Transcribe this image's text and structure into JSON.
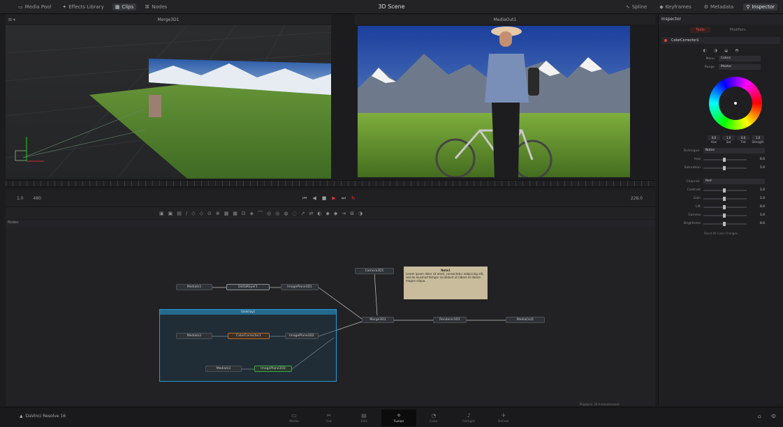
{
  "titlebar": {
    "title": "3D Scene",
    "left_buttons": [
      "Media Pool",
      "Effects Library",
      "Clips",
      "Nodes"
    ],
    "right_buttons": [
      "Spline",
      "Keyframes",
      "Metadata",
      "Inspector"
    ]
  },
  "viewer_left": {
    "name": "Merge3D1"
  },
  "viewer_right": {
    "name": "MediaOut1"
  },
  "transport": {
    "left_label": "1.0",
    "zoom": "480",
    "right_value": "228.0"
  },
  "nodes": {
    "panel_title": "Nodes",
    "items": [
      {
        "id": "camera3d1",
        "label": "Camera3D1"
      },
      {
        "id": "mediain1",
        "label": "MediaIn1"
      },
      {
        "id": "deltakeyer1",
        "label": "DeltaKeyer1"
      },
      {
        "id": "imageplane3d1",
        "label": "ImagePlane3D1"
      },
      {
        "id": "mediain2",
        "label": "MediaIn2"
      },
      {
        "id": "colorcorrector1",
        "label": "ColorCorrector1"
      },
      {
        "id": "imageplane3d2",
        "label": "ImagePlane3D2"
      },
      {
        "id": "merge3d1",
        "label": "Merge3D1"
      },
      {
        "id": "renderer3d1",
        "label": "Renderer3D1"
      },
      {
        "id": "mediaout1",
        "label": "MediaOut1"
      },
      {
        "id": "mediain3",
        "label": "MediaIn3"
      },
      {
        "id": "imageplane3d3",
        "label": "ImagePlane3D3"
      }
    ],
    "underlay_label": "Underlay1",
    "sticky": {
      "title": "Note1",
      "body": "Lorem ipsum dolor sit amet, consectetur adipiscing elit, sed do eiusmod tempor incididunt ut labore et dolore magna aliqua."
    }
  },
  "inspector": {
    "title": "Inspector",
    "tabs": [
      "Tools",
      "Modifiers"
    ],
    "tool_name": "ColorCorrector1",
    "menu_label": "Menu",
    "menu_value": "Colors",
    "range_label": "Range",
    "range_value": "Master",
    "rgba_labels": [
      "Hue",
      "Sat",
      "Tint",
      "Strength"
    ],
    "rgba_values": [
      "0.0",
      "1.0",
      "0.0",
      "1.0"
    ],
    "technique_label": "Technique",
    "technique_value": "Notes",
    "sliders_top": [
      {
        "label": "Hue",
        "value": "0.0"
      },
      {
        "label": "Saturation",
        "value": "1.0"
      }
    ],
    "channel_label": "Channel",
    "channel_value": "Red",
    "sliders_bottom": [
      {
        "label": "Contrast",
        "value": "1.0"
      },
      {
        "label": "Gain",
        "value": "1.0"
      },
      {
        "label": "Lift",
        "value": "0.0"
      },
      {
        "label": "Gamma",
        "value": "1.0"
      },
      {
        "label": "Brightness",
        "value": "0.0"
      }
    ],
    "footer": "Reset All Color Changes"
  },
  "bottom": {
    "project": "DaVinci Resolve 16",
    "pages": [
      "Media",
      "Cut",
      "Edit",
      "Fusion",
      "Color",
      "Fairlight",
      "Deliver"
    ],
    "active_page": "Fusion",
    "status": "Playback: 24 frames/second"
  }
}
